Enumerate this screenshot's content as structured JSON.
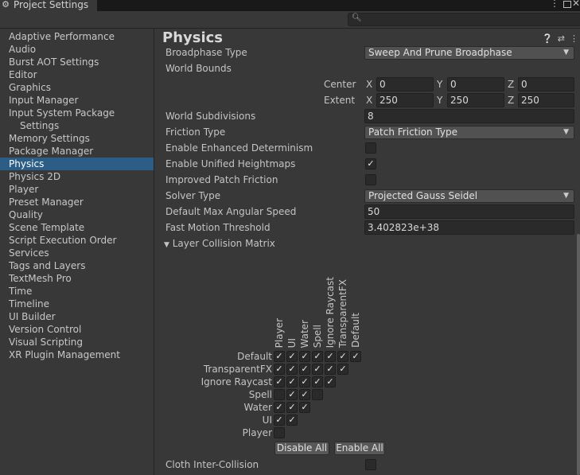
{
  "window": {
    "tab_title": "Project Settings"
  },
  "search": {
    "placeholder": ""
  },
  "sidebar": {
    "items": [
      {
        "label": "Adaptive Performance"
      },
      {
        "label": "Audio"
      },
      {
        "label": "Burst AOT Settings"
      },
      {
        "label": "Editor"
      },
      {
        "label": "Graphics"
      },
      {
        "label": "Input Manager"
      },
      {
        "label": "Input System Package"
      },
      {
        "label": "Settings"
      },
      {
        "label": "Memory Settings"
      },
      {
        "label": "Package Manager"
      },
      {
        "label": "Physics"
      },
      {
        "label": "Physics 2D"
      },
      {
        "label": "Player"
      },
      {
        "label": "Preset Manager"
      },
      {
        "label": "Quality"
      },
      {
        "label": "Scene Template"
      },
      {
        "label": "Script Execution Order"
      },
      {
        "label": "Services"
      },
      {
        "label": "Tags and Layers"
      },
      {
        "label": "TextMesh Pro"
      },
      {
        "label": "Time"
      },
      {
        "label": "Timeline"
      },
      {
        "label": "UI Builder"
      },
      {
        "label": "Version Control"
      },
      {
        "label": "Visual Scripting"
      },
      {
        "label": "XR Plugin Management"
      }
    ],
    "selected": "Physics"
  },
  "main": {
    "title": "Physics",
    "broadphase_label": "Broadphase Type",
    "broadphase_value": "Sweep And Prune Broadphase",
    "world_bounds_label": "World Bounds",
    "center_label": "Center",
    "extent_label": "Extent",
    "x": "X",
    "y": "Y",
    "z": "Z",
    "center": {
      "x": "0",
      "y": "0",
      "z": "0"
    },
    "extent": {
      "x": "250",
      "y": "250",
      "z": "250"
    },
    "subdivisions_label": "World Subdivisions",
    "subdivisions_value": "8",
    "friction_label": "Friction Type",
    "friction_value": "Patch Friction Type",
    "determinism_label": "Enable Enhanced Determinism",
    "determinism_checked": false,
    "heightmaps_label": "Enable Unified Heightmaps",
    "heightmaps_checked": true,
    "patch_friction_label": "Improved Patch Friction",
    "patch_friction_checked": false,
    "solver_label": "Solver Type",
    "solver_value": "Projected Gauss Seidel",
    "angular_label": "Default Max Angular Speed",
    "angular_value": "50",
    "fast_motion_label": "Fast Motion Threshold",
    "fast_motion_value": "3.402823e+38",
    "matrix_label": "Layer Collision Matrix",
    "cloth_label": "Cloth Inter-Collision",
    "cloth_checked": false
  },
  "matrix": {
    "columns": [
      "Player",
      "UI",
      "Water",
      "Spell",
      "Ignore Raycast",
      "TransparentFX",
      "Default"
    ],
    "rows": [
      {
        "label": "Default",
        "cells": [
          true,
          true,
          true,
          true,
          true,
          true,
          true
        ]
      },
      {
        "label": "TransparentFX",
        "cells": [
          true,
          true,
          true,
          true,
          true,
          true
        ]
      },
      {
        "label": "Ignore Raycast",
        "cells": [
          true,
          true,
          true,
          true,
          true
        ]
      },
      {
        "label": "Spell",
        "cells": [
          false,
          true,
          true,
          false
        ]
      },
      {
        "label": "Water",
        "cells": [
          true,
          true,
          true
        ]
      },
      {
        "label": "UI",
        "cells": [
          true,
          true
        ]
      },
      {
        "label": "Player",
        "cells": [
          false
        ]
      }
    ],
    "disable_all": "Disable All",
    "enable_all": "Enable All"
  },
  "icons": {
    "settings": "gear-icon",
    "help": "help-icon",
    "presets": "sliders-icon",
    "menu": "kebab-menu-icon",
    "search": "search-icon"
  }
}
